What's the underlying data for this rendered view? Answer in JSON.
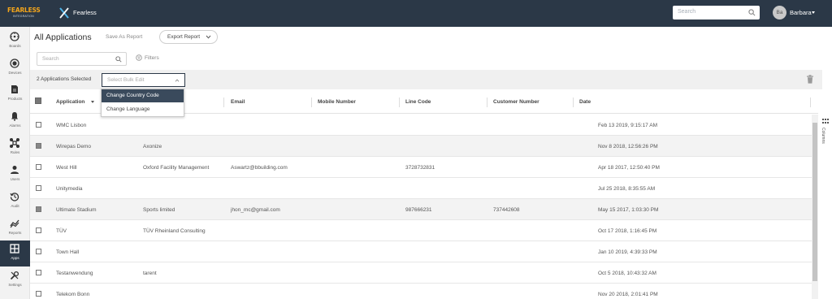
{
  "topbar": {
    "logo_text": "FEARLESS",
    "logo_sub": "INTEGRATION",
    "app_name": "Fearless",
    "search_placeholder": "Search",
    "avatar_initials": "Ba",
    "user_name": "Barbara",
    "colors": {
      "bg": "#2b3847",
      "logo": "#f3a51b"
    }
  },
  "sidebar": {
    "items": [
      {
        "label": "Boards",
        "icon": "dashboard-icon"
      },
      {
        "label": "Devices",
        "icon": "device-icon"
      },
      {
        "label": "Products",
        "icon": "product-icon"
      },
      {
        "label": "Alarms",
        "icon": "bell-icon"
      },
      {
        "label": "Rules",
        "icon": "rules-icon"
      },
      {
        "label": "Users",
        "icon": "user-icon"
      },
      {
        "label": "Audit",
        "icon": "history-icon"
      },
      {
        "label": "Reports",
        "icon": "reports-icon"
      },
      {
        "label": "Apps",
        "icon": "apps-icon",
        "active": true
      },
      {
        "label": "Settings",
        "icon": "tools-icon"
      }
    ]
  },
  "header": {
    "title": "All Applications",
    "save_report": "Save As Report",
    "export_report": "Export Report"
  },
  "toolbar": {
    "search_placeholder": "Search",
    "filters": "Filters"
  },
  "selection": {
    "count_label": "2 Applications Selected",
    "bulk_placeholder": "Select Bulk Edit",
    "dropdown": [
      "Change Country Code",
      "Change Language"
    ]
  },
  "table": {
    "columns": [
      "Application",
      "Email",
      "Mobile Number",
      "Line Code",
      "Customer Number",
      "Date"
    ],
    "rows": [
      {
        "app": "WMC Lisbon",
        "company": "",
        "email": "",
        "mobile": "",
        "line": "",
        "customer": "",
        "date": "Feb 13 2019, 9:15:17 AM",
        "selected": false
      },
      {
        "app": "Wirepas Demo",
        "company": "Axonize",
        "email": "",
        "mobile": "",
        "line": "",
        "customer": "",
        "date": "Nov 8 2018, 12:56:26 PM",
        "selected": true
      },
      {
        "app": "West Hill",
        "company": "Oxford Facility Management",
        "email": "Aswartz@bbuilding.com",
        "mobile": "3728732831",
        "line": "",
        "customer": "",
        "date": "Apr 18 2017, 12:50:40 PM",
        "selected": false
      },
      {
        "app": "Unitymedia",
        "company": "",
        "email": "",
        "mobile": "",
        "line": "",
        "customer": "",
        "date": "Jul 25 2018, 8:35:55 AM",
        "selected": false
      },
      {
        "app": "Ultimate Stadium",
        "company": "Sports limited",
        "email": "jhon_mc@gmail.com",
        "mobile": "987666231",
        "line": "737442608",
        "customer": "",
        "date": "May 15 2017, 1:03:30 PM",
        "selected": true
      },
      {
        "app": "TÜV",
        "company": "TÜV Rheinland Consulting",
        "email": "",
        "mobile": "",
        "line": "",
        "customer": "",
        "date": "Oct 17 2018, 1:16:45 PM",
        "selected": false
      },
      {
        "app": "Town Hall",
        "company": "",
        "email": "",
        "mobile": "",
        "line": "",
        "customer": "",
        "date": "Jan 10 2019, 4:39:33 PM",
        "selected": false
      },
      {
        "app": "Testanwendung",
        "company": "tarent",
        "email": "",
        "mobile": "",
        "line": "",
        "customer": "",
        "date": "Oct 5 2018, 10:43:32 AM",
        "selected": false
      },
      {
        "app": "Telekom Bonn",
        "company": "",
        "email": "",
        "mobile": "",
        "line": "",
        "customer": "",
        "date": "Nov 20 2018, 2:01:41 PM",
        "selected": false
      }
    ]
  },
  "columns_panel": {
    "label": "Columns"
  }
}
